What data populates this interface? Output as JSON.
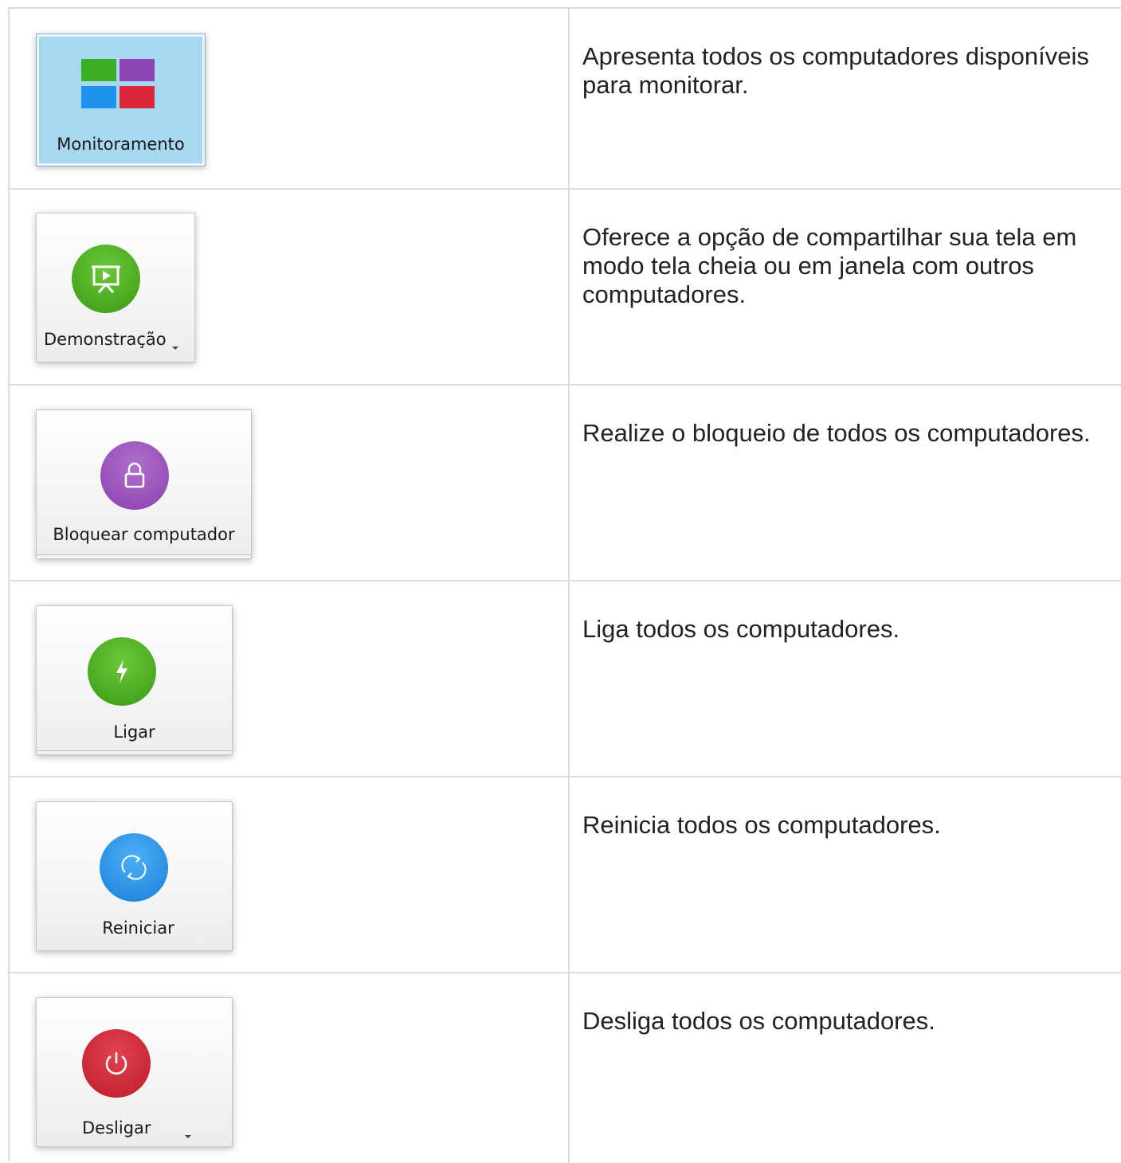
{
  "rows": [
    {
      "button_label": "Monitoramento",
      "icon": "monitor-grid-icon",
      "description": "Apresenta todos os computadores disponíveis para monitorar.",
      "colors": [
        "#3cae24",
        "#8e44b3",
        "#1e90ee",
        "#d9283c"
      ]
    },
    {
      "button_label": "Demonstração",
      "icon": "presentation-icon",
      "description": "Oferece a opção de compartilhar sua tela em modo tela cheia ou em janela com outros computadores.",
      "color": "#4aae20"
    },
    {
      "button_label": "Bloquear computador",
      "icon": "lock-icon",
      "description": "Realize o bloqueio de todos os computadores.",
      "color": "#9a55b8"
    },
    {
      "button_label": "Ligar",
      "icon": "lightning-icon",
      "description": "Liga todos os computadores.",
      "color": "#4aae20"
    },
    {
      "button_label": "Reiniciar",
      "icon": "refresh-icon",
      "description": "Reinicia todos os computadores.",
      "color": "#1e8fe6"
    },
    {
      "button_label": "Desligar",
      "icon": "power-icon",
      "description": "Desliga todos os computadores.",
      "color": "#d02434"
    }
  ]
}
